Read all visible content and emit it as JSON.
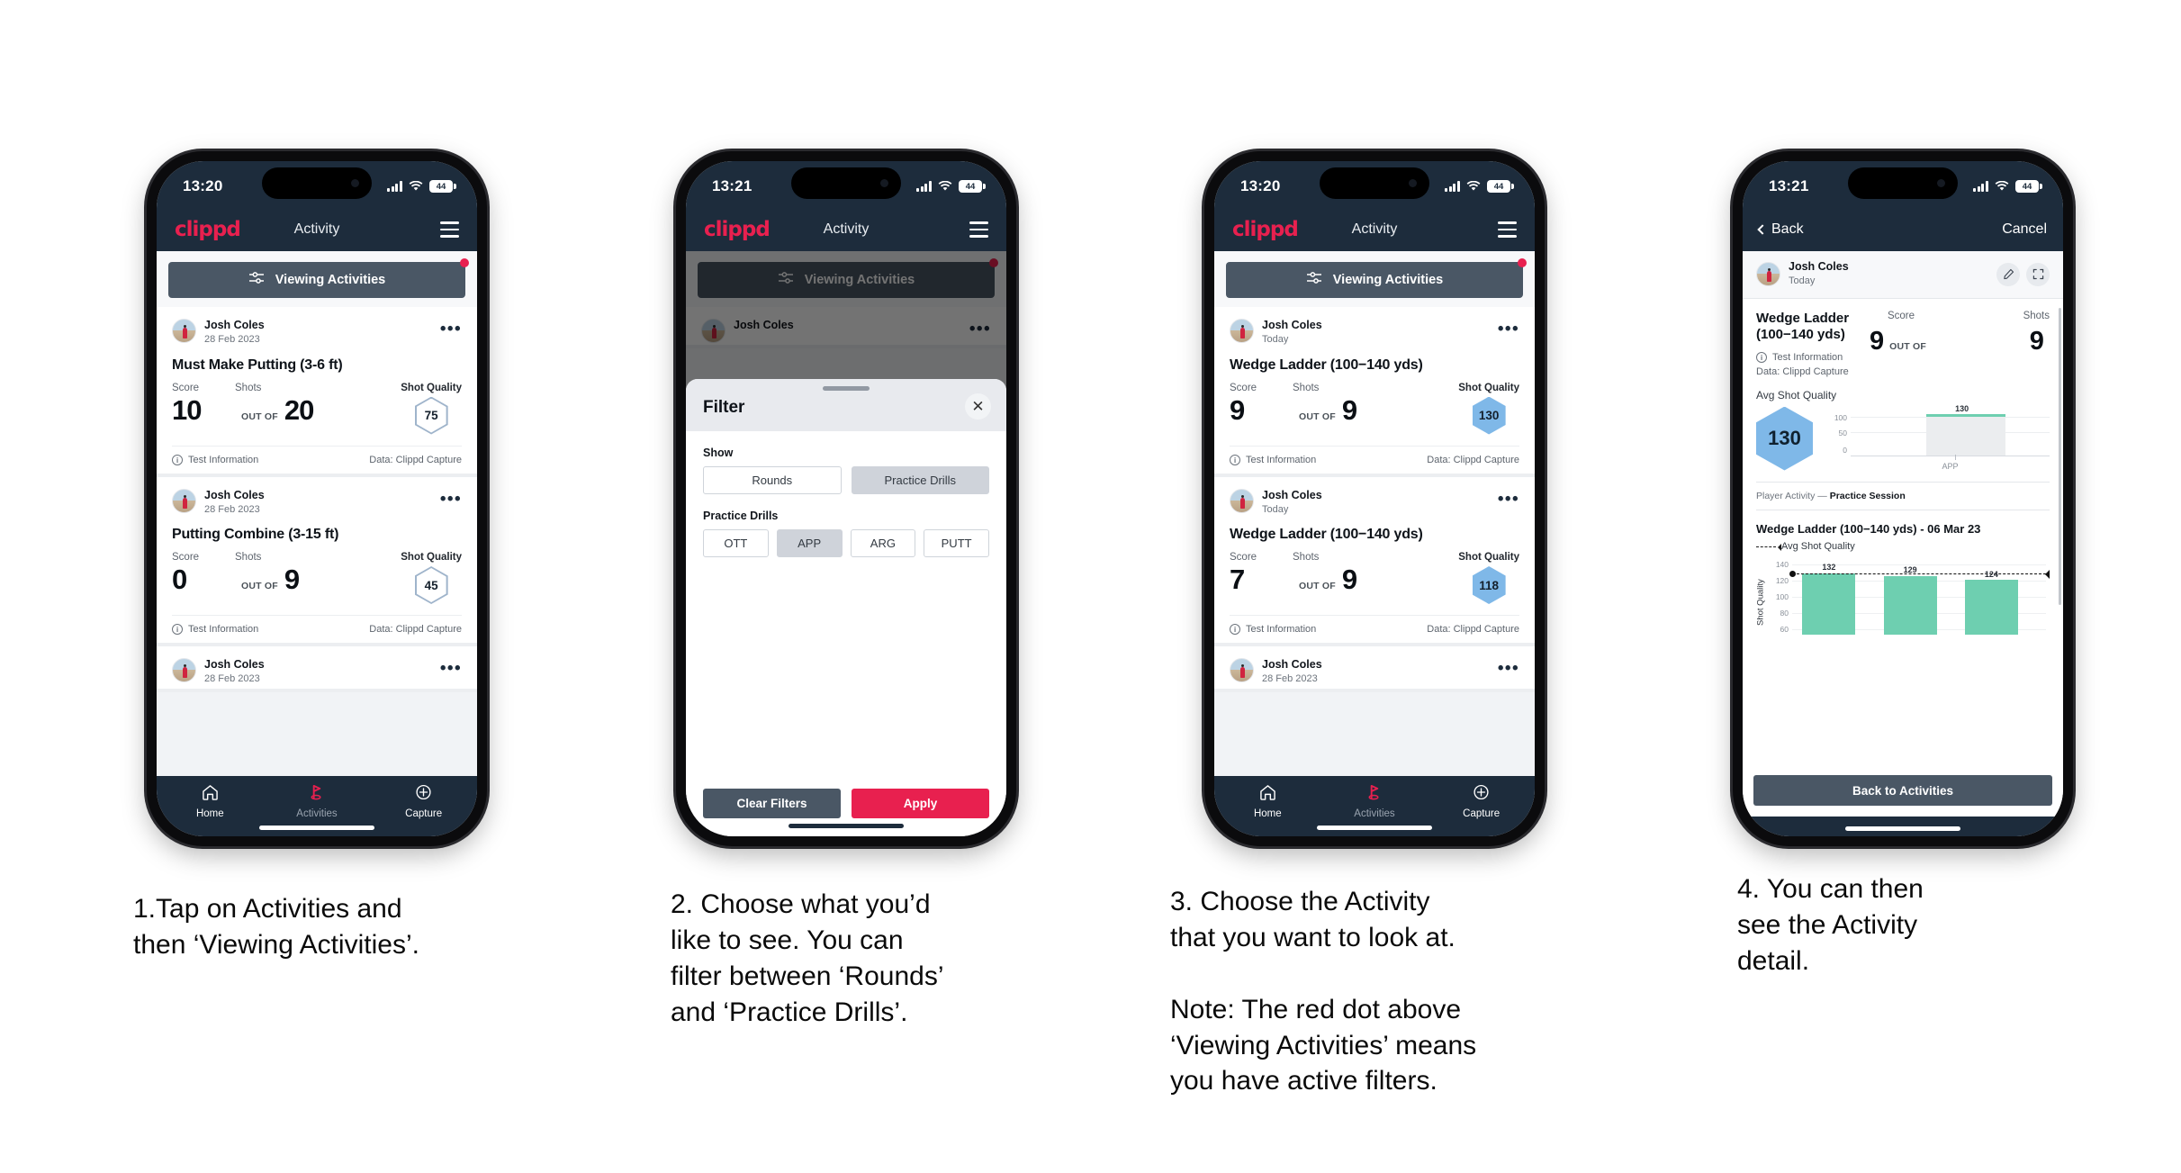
{
  "phones": [
    {
      "status": {
        "time": "13:20",
        "battery": "44"
      },
      "appbar": {
        "logo": "clippd",
        "title": "Activity"
      },
      "viewbar": {
        "label": "Viewing Activities",
        "has_red_dot": true
      },
      "cards": [
        {
          "user": "Josh Coles",
          "date": "28 Feb 2023",
          "title": "Must Make Putting (3-6 ft)",
          "score_label": "Score",
          "shots_label": "Shots",
          "quality_label": "Shot Quality",
          "score": "10",
          "outof": "OUT OF",
          "shots": "20",
          "quality": "75",
          "quality_style": "outline",
          "test_info": "Test Information",
          "data_source": "Data: Clippd Capture"
        },
        {
          "user": "Josh Coles",
          "date": "28 Feb 2023",
          "title": "Putting Combine (3-15 ft)",
          "score_label": "Score",
          "shots_label": "Shots",
          "quality_label": "Shot Quality",
          "score": "0",
          "outof": "OUT OF",
          "shots": "9",
          "quality": "45",
          "quality_style": "outline",
          "test_info": "Test Information",
          "data_source": "Data: Clippd Capture"
        },
        {
          "user": "Josh Coles",
          "date": "28 Feb 2023"
        }
      ],
      "nav": {
        "home": "Home",
        "activities": "Activities",
        "capture": "Capture"
      }
    },
    {
      "status": {
        "time": "13:21",
        "battery": "44"
      },
      "appbar": {
        "logo": "clippd",
        "title": "Activity"
      },
      "viewbar": {
        "label": "Viewing Activities",
        "has_red_dot": true
      },
      "behind_card_user": "Josh Coles",
      "sheet": {
        "title": "Filter",
        "close_icon": "close-icon",
        "show_label": "Show",
        "show_options": [
          {
            "label": "Rounds",
            "selected": false
          },
          {
            "label": "Practice Drills",
            "selected": true
          }
        ],
        "drills_label": "Practice Drills",
        "drill_options": [
          {
            "label": "OTT",
            "selected": false
          },
          {
            "label": "APP",
            "selected": true
          },
          {
            "label": "ARG",
            "selected": false
          },
          {
            "label": "PUTT",
            "selected": false
          }
        ],
        "clear_label": "Clear Filters",
        "apply_label": "Apply"
      }
    },
    {
      "status": {
        "time": "13:20",
        "battery": "44"
      },
      "appbar": {
        "logo": "clippd",
        "title": "Activity"
      },
      "viewbar": {
        "label": "Viewing Activities",
        "has_red_dot": true
      },
      "cards": [
        {
          "user": "Josh Coles",
          "date": "Today",
          "title": "Wedge Ladder (100−140 yds)",
          "score_label": "Score",
          "shots_label": "Shots",
          "quality_label": "Shot Quality",
          "score": "9",
          "outof": "OUT OF",
          "shots": "9",
          "quality": "130",
          "quality_style": "filled",
          "test_info": "Test Information",
          "data_source": "Data: Clippd Capture"
        },
        {
          "user": "Josh Coles",
          "date": "Today",
          "title": "Wedge Ladder (100−140 yds)",
          "score_label": "Score",
          "shots_label": "Shots",
          "quality_label": "Shot Quality",
          "score": "7",
          "outof": "OUT OF",
          "shots": "9",
          "quality": "118",
          "quality_style": "filled",
          "test_info": "Test Information",
          "data_source": "Data: Clippd Capture"
        },
        {
          "user": "Josh Coles",
          "date": "28 Feb 2023"
        }
      ],
      "nav": {
        "home": "Home",
        "activities": "Activities",
        "capture": "Capture"
      }
    },
    {
      "status": {
        "time": "13:21",
        "battery": "44"
      },
      "backbar": {
        "back": "Back",
        "cancel": "Cancel"
      },
      "detail": {
        "user": "Josh Coles",
        "date": "Today",
        "edit_icon": "pencil-icon",
        "expand_icon": "expand-icon",
        "title": "Wedge Ladder (100−140 yds)",
        "score_label": "Score",
        "shots_label": "Shots",
        "score": "9",
        "outof": "OUT OF",
        "shots": "9",
        "test_info": "Test Information",
        "data_source": "Data: Clippd Capture",
        "avg_label": "Avg Shot Quality",
        "avg_value": "130",
        "player_activity_prefix": "Player Activity —",
        "player_activity_value": "Practice Session",
        "session_title": "Wedge Ladder (100−140 yds) - 06 Mar 23",
        "legend_label": "Avg Shot Quality",
        "back_button": "Back to Activities"
      }
    }
  ],
  "captions": [
    {
      "lines": [
        "1.Tap on Activities and",
        "then ‘Viewing Activities’."
      ]
    },
    {
      "lines": [
        "2. Choose what you’d",
        "like to see. You can",
        "filter between ‘Rounds’",
        "and ‘Practice Drills’."
      ]
    },
    {
      "lines": [
        "3. Choose the Activity",
        "that you want to look at."
      ],
      "lines2": [
        "Note: The red dot above",
        "‘Viewing Activities’ means",
        "you have active filters."
      ]
    },
    {
      "lines": [
        "4. You can then",
        "see the Activity",
        "detail."
      ]
    }
  ],
  "colors": {
    "brand_red": "#e8204f",
    "dark_navy": "#1d2c3c",
    "slate": "#4a5765",
    "hex_blue": "#7fb8e8",
    "bar_green": "#6ecfb0"
  },
  "chart_data": [
    {
      "type": "bar",
      "title": "Avg Shot Quality",
      "categories": [
        "APP"
      ],
      "values": [
        130
      ],
      "data_labels": [
        "130"
      ],
      "ylabel": "",
      "ytick_labels": [
        "0",
        "50",
        "100"
      ],
      "yticks": [
        0,
        50,
        100
      ],
      "ylim": [
        0,
        140
      ],
      "grid": true,
      "legend": "none"
    },
    {
      "type": "bar",
      "title": "Wedge Ladder (100−140 yds) - 06 Mar 23",
      "categories": [
        "",
        "",
        ""
      ],
      "values": [
        132,
        129,
        124
      ],
      "data_labels": [
        "132",
        "129",
        "124"
      ],
      "ylabel": "Shot Quality",
      "ytick_labels": [
        "60",
        "80",
        "100",
        "120",
        "140"
      ],
      "yticks": [
        60,
        80,
        100,
        120,
        140
      ],
      "ylim": [
        50,
        145
      ],
      "grid": true,
      "legend": "Avg Shot Quality",
      "legend_position": "top-left",
      "annotations": [
        {
          "type": "avg-line",
          "label": "Avg Shot Quality",
          "value": 130,
          "style": "dashed"
        }
      ]
    }
  ]
}
